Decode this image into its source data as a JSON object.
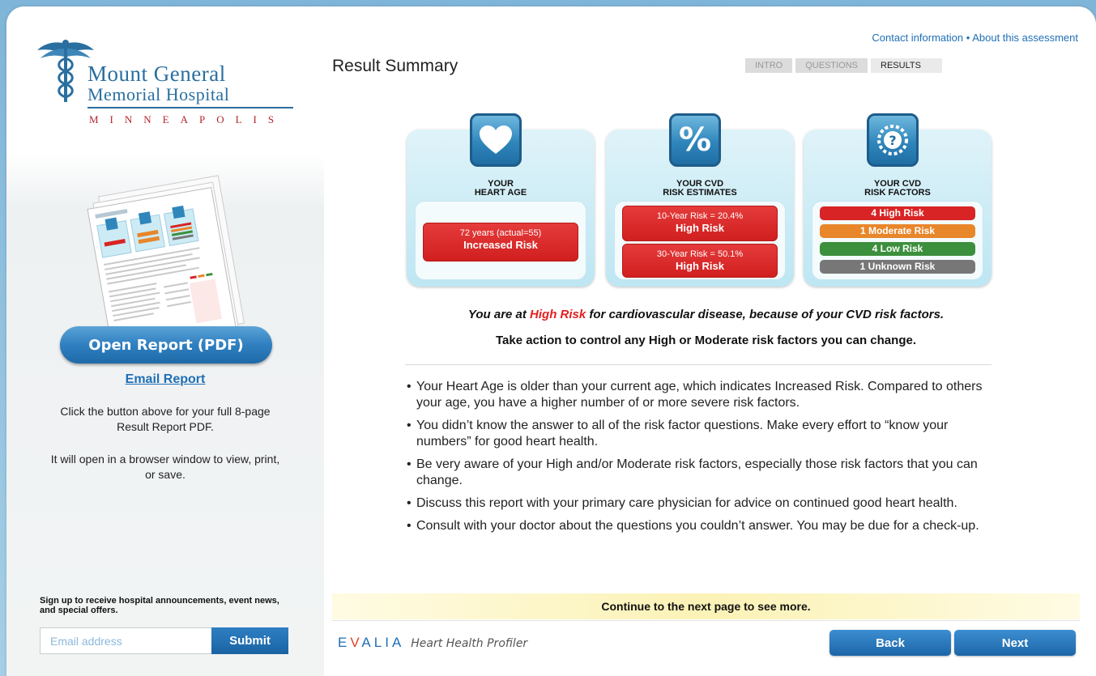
{
  "hospital": {
    "name_line1": "Mount General",
    "name_line2": "Memorial Hospital",
    "city": "MINNEAPOLIS"
  },
  "sidebar": {
    "open_report_label": "Open Report (PDF)",
    "email_report_label": "Email Report",
    "desc1": "Click the button above for your full 8-page Result Report PDF.",
    "desc2": "It will open in a browser window to view, print, or save.",
    "signup_text": "Sign up to receive hospital announcements, event news, and special offers.",
    "email_placeholder": "Email address",
    "submit_label": "Submit"
  },
  "header": {
    "contact_link": "Contact information",
    "separator": "•",
    "about_link": "About this assessment",
    "page_title": "Result Summary",
    "tabs": [
      {
        "label": "INTRO",
        "active": false
      },
      {
        "label": "QUESTIONS",
        "active": false
      },
      {
        "label": "RESULTS",
        "active": true
      }
    ]
  },
  "cards": {
    "heart_age": {
      "icon": "heart-icon",
      "title_l1": "YOUR",
      "title_l2": "HEART AGE",
      "value": "72 years (actual=55)",
      "status": "Increased Risk"
    },
    "risk_estimates": {
      "icon": "percent-icon",
      "title_l1": "YOUR CVD",
      "title_l2": "RISK ESTIMATES",
      "ten_year": "10-Year Risk = 20.4%",
      "ten_year_status": "High Risk",
      "thirty_year": "30-Year Risk = 50.1%",
      "thirty_year_status": "High Risk"
    },
    "risk_factors": {
      "icon": "question-gear-icon",
      "title_l1": "YOUR CVD",
      "title_l2": "RISK FACTORS",
      "items": [
        {
          "label": "4 High Risk",
          "color": "#d82424"
        },
        {
          "label": "1 Moderate Risk",
          "color": "#e8862a"
        },
        {
          "label": "4 Low Risk",
          "color": "#3c8f3c"
        },
        {
          "label": "1 Unknown Risk",
          "color": "#777777"
        }
      ]
    }
  },
  "summary": {
    "pre": "You are at ",
    "highlight": "High Risk",
    "post": " for cardiovascular disease, because of your CVD risk factors.",
    "action": "Take action to control any High or Moderate risk factors you can change."
  },
  "bullets": [
    "Your Heart Age is older than your current age, which indicates Increased Risk. Compared to others your age, you have a higher number of or more severe risk factors.",
    "You didn’t know the answer to all of the risk factor questions. Make every effort to “know your numbers” for good heart health.",
    "Be very aware of your High and/or Moderate risk factors, especially those risk factors that you can change.",
    "Discuss this report with your primary care physician for advice on continued good heart health.",
    "Consult with your doctor about the questions you couldn’t answer. You may be due for a check-up."
  ],
  "footer": {
    "continue_text": "Continue to the next page to see more.",
    "brand_pre": "E",
    "brand_v": "V",
    "brand_post": "ALIA",
    "brand_sub": "Heart Health Profiler",
    "back_label": "Back",
    "next_label": "Next"
  },
  "colors": {
    "accent": "#1f6fb6",
    "high_risk": "#d82424",
    "moderate_risk": "#e8862a",
    "low_risk": "#3c8f3c",
    "unknown_risk": "#777777"
  }
}
